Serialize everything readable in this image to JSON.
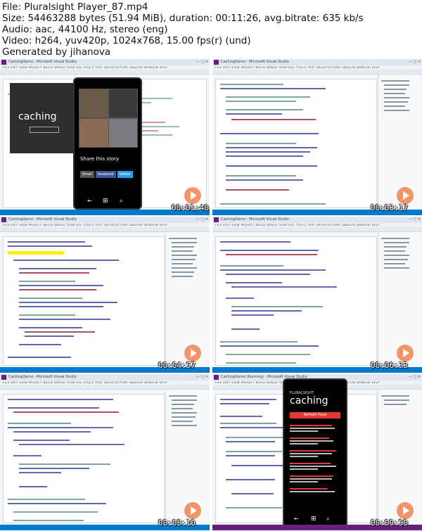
{
  "header": {
    "file_line": "File: Pluralsight Player_87.mp4",
    "size_line": "Size: 54463288 bytes (51.94 MiB), duration: 00:11:26, avg.bitrate: 635 kb/s",
    "audio_line": "Audio: aac, 44100 Hz, stereo (eng)",
    "video_line": "Video: h264, yuv420p, 1024x768, 15.00 fps(r) (und)",
    "generated_line": "Generated by jihanova"
  },
  "thumbnails": [
    {
      "timestamp": "00:01:40",
      "window_title": "CachingDemo - Microsoft Visual Studio",
      "app_caption": "caching"
    },
    {
      "timestamp": "00:03:17",
      "window_title": "CachingDemo - Microsoft Visual Studio"
    },
    {
      "timestamp": "00:04:57",
      "window_title": "CachingDemo - Microsoft Visual Studio"
    },
    {
      "timestamp": "00:06:33",
      "window_title": "CachingDemo - Microsoft Visual Studio"
    },
    {
      "timestamp": "00:08:10",
      "window_title": "CachingDemo - Microsoft Visual Studio"
    },
    {
      "timestamp": "00:09:50",
      "window_title": "CachingDemo (Running) - Microsoft Visual Studio",
      "app_caption": "caching",
      "app_header": "PLURALSIGHT",
      "refresh_label": "Refresh Feed"
    }
  ],
  "phone1": {
    "share_title": "Share this story",
    "share_buttons": [
      "Email",
      "facebook",
      "twitter"
    ]
  },
  "colors": {
    "accent": "#007acc",
    "running": "#68217a",
    "play": "#f08a5a",
    "feed_red": "#e53935"
  }
}
